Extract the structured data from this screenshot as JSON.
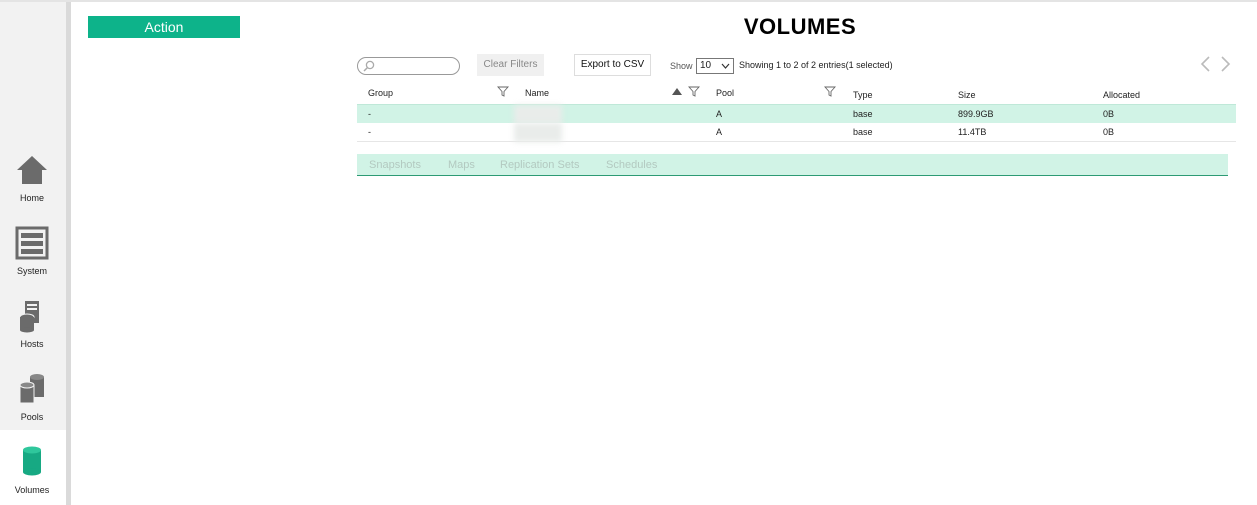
{
  "nav": {
    "items": [
      {
        "label": "Home",
        "icon": "home-icon"
      },
      {
        "label": "System",
        "icon": "system-icon"
      },
      {
        "label": "Hosts",
        "icon": "hosts-icon"
      },
      {
        "label": "Pools",
        "icon": "pools-icon"
      },
      {
        "label": "Volumes",
        "icon": "volumes-icon",
        "active": true
      }
    ]
  },
  "action": {
    "label": "Action"
  },
  "page": {
    "title": "VOLUMES"
  },
  "toolbar": {
    "search_placeholder": "",
    "clear_filters": "Clear Filters",
    "export_csv": "Export to CSV",
    "show_label": "Show",
    "show_value": "10",
    "entries_info": "Showing 1 to 2 of 2 entries(1 selected)"
  },
  "table": {
    "columns": [
      "Group",
      "Name",
      "Pool",
      "Type",
      "Size",
      "Allocated"
    ],
    "rows": [
      {
        "group": "-",
        "name": "",
        "pool": "A",
        "type": "base",
        "size": "899.9GB",
        "allocated": "0B",
        "selected": true
      },
      {
        "group": "-",
        "name": "",
        "pool": "A",
        "type": "base",
        "size": "11.4TB",
        "allocated": "0B",
        "selected": false
      }
    ]
  },
  "subtabs": [
    "Snapshots",
    "Maps",
    "Replication Sets",
    "Schedules"
  ],
  "colors": {
    "accent": "#0db38a",
    "selected_row": "#d1f3e6",
    "volumes_icon": "#17a983",
    "nav_icon": "#6b6b6b"
  }
}
